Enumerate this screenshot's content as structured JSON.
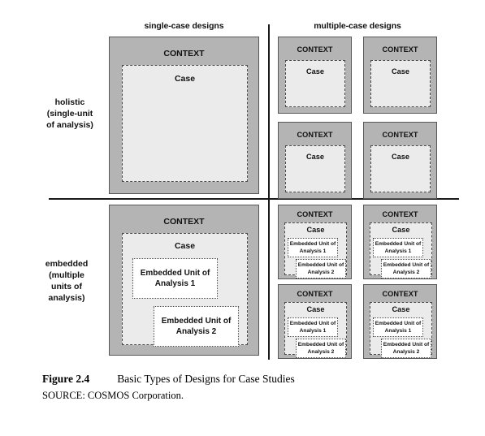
{
  "figure": {
    "columns": [
      {
        "id": "single",
        "label": "single-case designs"
      },
      {
        "id": "multiple",
        "label": "multiple-case designs"
      }
    ],
    "rows": [
      {
        "id": "holistic",
        "label": "holistic\n(single-unit\nof analysis)"
      },
      {
        "id": "embedded",
        "label": "embedded\n(multiple\nunits of\nanalysis)"
      }
    ],
    "labels": {
      "context": "CONTEXT",
      "case": "Case",
      "unit1": "Embedded Unit of\nAnalysis 1",
      "unit2": "Embedded Unit of\nAnalysis 2"
    },
    "colors": {
      "context_fill": "#b4b4b4",
      "context_border": "#575757",
      "case_fill": "#ebebeb",
      "case_border": "#4a4a4a",
      "unit_fill": "#ffffff",
      "unit_border": "#4a4a4a",
      "divider": "#1a1a1a",
      "background": "#ffffff"
    },
    "quadrants": {
      "single_holistic": {
        "context": "CONTEXT",
        "case": "Case",
        "count": 1
      },
      "multiple_holistic": {
        "context": "CONTEXT",
        "case": "Case",
        "count": 4
      },
      "single_embedded": {
        "context": "CONTEXT",
        "case": "Case",
        "count": 1,
        "units": 2
      },
      "multiple_embedded": {
        "context": "CONTEXT",
        "case": "Case",
        "count": 4,
        "units": 2
      }
    }
  },
  "caption": {
    "figure_number": "Figure 2.4",
    "title": "Basic Types of Designs for Case Studies",
    "source": "SOURCE: COSMOS Corporation."
  }
}
